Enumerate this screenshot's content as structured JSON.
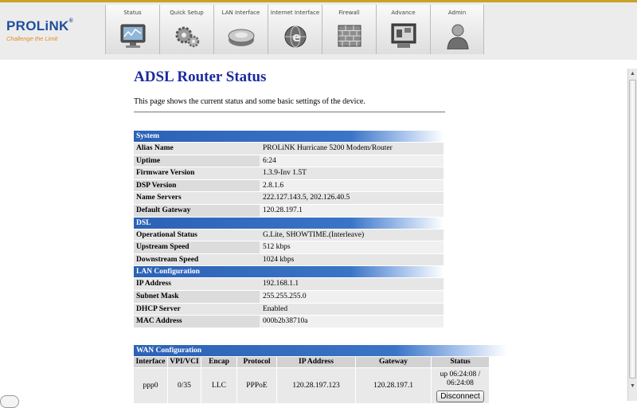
{
  "brand": {
    "name": "PROLiNK",
    "reg": "®",
    "slogan": "Challenge the Limit"
  },
  "nav": [
    {
      "label": "Status",
      "icon": "monitor-icon"
    },
    {
      "label": "Quick Setup",
      "icon": "gears-icon"
    },
    {
      "label": "LAN Interface",
      "icon": "hard-drive-icon"
    },
    {
      "label": "Internet Interface",
      "icon": "globe-icon"
    },
    {
      "label": "Firewall",
      "icon": "brick-wall-icon"
    },
    {
      "label": "Advance",
      "icon": "computer-icon"
    },
    {
      "label": "Admin",
      "icon": "user-icon"
    }
  ],
  "page": {
    "title": "ADSL Router Status",
    "description": "This page shows the current status and some basic settings of the device."
  },
  "system": {
    "header": "System",
    "rows": [
      {
        "label": "Alias Name",
        "value": "PROLiNK Hurricane 5200 Modem/Router"
      },
      {
        "label": "Uptime",
        "value": "6:24"
      },
      {
        "label": "Firmware Version",
        "value": "1.3.9-Inv 1.5T"
      },
      {
        "label": "DSP Version",
        "value": "2.8.1.6"
      },
      {
        "label": "Name Servers",
        "value": "222.127.143.5, 202.126.40.5"
      },
      {
        "label": "Default Gateway",
        "value": "120.28.197.1"
      }
    ]
  },
  "dsl": {
    "header": "DSL",
    "rows": [
      {
        "label": "Operational Status",
        "value": "G.Lite, SHOWTIME.(Interleave)"
      },
      {
        "label": "Upstream Speed",
        "value": "512 kbps"
      },
      {
        "label": "Downstream Speed",
        "value": "1024 kbps"
      }
    ]
  },
  "lan": {
    "header": "LAN Configuration",
    "rows": [
      {
        "label": "IP Address",
        "value": "192.168.1.1"
      },
      {
        "label": "Subnet Mask",
        "value": "255.255.255.0"
      },
      {
        "label": "DHCP Server",
        "value": "Enabled"
      },
      {
        "label": "MAC Address",
        "value": "000b2b38710a"
      }
    ]
  },
  "wan": {
    "header": "WAN Configuration",
    "columns": [
      "Interface",
      "VPI/VCI",
      "Encap",
      "Protocol",
      "IP Address",
      "Gateway",
      "Status"
    ],
    "row": {
      "interface": "ppp0",
      "vpi_vci": "0/35",
      "encap": "LLC",
      "protocol": "PPPoE",
      "ip": "120.28.197.123",
      "gateway": "120.28.197.1",
      "status_line1": "up 06:24:08 /",
      "status_line2": "06:24:08",
      "button": "Disconnect"
    }
  },
  "colors": {
    "title": "#1b2aa0",
    "section": "#2c62b6",
    "accent": "#c9a227"
  }
}
